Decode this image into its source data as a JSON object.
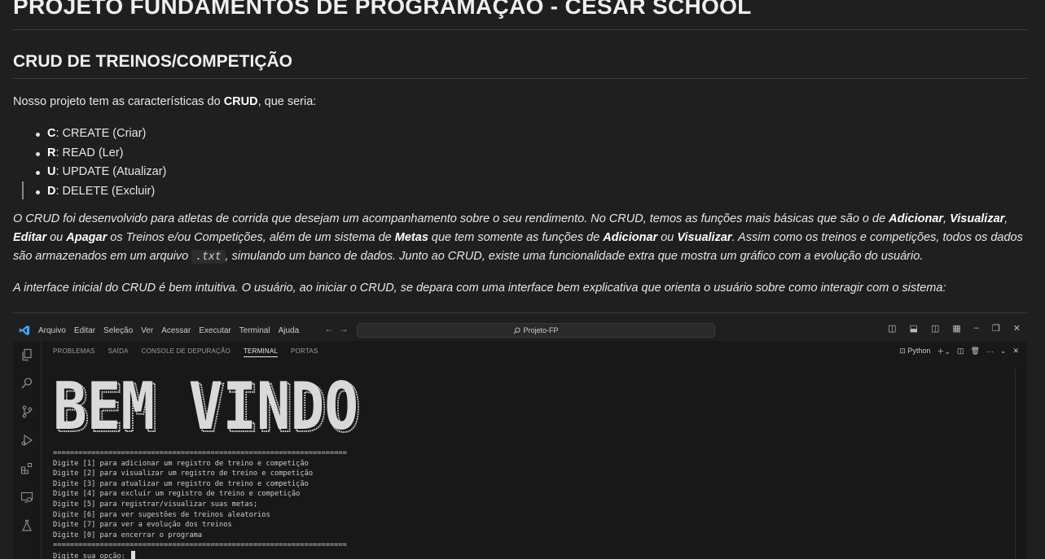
{
  "header": {
    "title": "PROJETO FUNDAMENTOS DE PROGRAMAÇÃO - CESAR SCHOOL",
    "subtitle": "CRUD DE TREINOS/COMPETIÇÃO"
  },
  "intro": {
    "before": "Nosso projeto tem as características do ",
    "bold": "CRUD",
    "after": ", que seria:"
  },
  "crud_items": [
    {
      "letter": "C",
      "text": ": CREATE (Criar)"
    },
    {
      "letter": "R",
      "text": ": READ (Ler)"
    },
    {
      "letter": "U",
      "text": ": UPDATE (Atualizar)"
    },
    {
      "letter": "D",
      "text": ": DELETE (Excluir)"
    }
  ],
  "description": {
    "t1": "O CRUD foi desenvolvido para atletas de corrida que desejam um acompanhamento sobre o seu rendimento. No CRUD, temos as funções mais básicas que são o de ",
    "b1": "Adicionar",
    "t2": ", ",
    "b2": "Visualizar",
    "t3": ", ",
    "b3": "Editar",
    "t4": " ou ",
    "b4": "Apagar",
    "t5": " os Treinos e/ou Competições, além de um sistema de ",
    "b5": "Metas",
    "t6": " que tem somente as funções de ",
    "b6": "Adicionar",
    "t7": " ou ",
    "b7": "Visualizar",
    "t8": ". Assim como os treinos e competições, todos os dados são armazenados em um arquivo ",
    "code": ".txt",
    "t9": ", simulando um banco de dados. Junto ao CRUD, existe uma funcionalidade extra que mostra um gráfico com a evolução do usuário."
  },
  "interface_note": "A interface inicial do CRUD é bem intuitiva. O usuário, ao iniciar o CRUD, se depara com uma interface bem explicativa que orienta o usuário sobre como interagir com o sistema:",
  "vscode": {
    "menu": [
      "Arquivo",
      "Editar",
      "Seleção",
      "Ver",
      "Acessar",
      "Executar",
      "Terminal",
      "Ajuda"
    ],
    "search_text": "Projeto-FP",
    "panel_tabs": [
      "PROBLEMAS",
      "SAÍDA",
      "CONSOLE DE DEPURAÇÃO",
      "TERMINAL",
      "PORTAS"
    ],
    "active_tab": "TERMINAL",
    "terminal_profile": "Python",
    "banner_text": "BEM VINDO",
    "terminal_lines": [
      "=====================================================================",
      "Digite [1] para adicionar um registro de treino e competição",
      "Digite [2] para visualizar um registro de treino e competição",
      "Digite [3] para atualizar um registro de treino e competição",
      "Digite [4] para excluir um registro de treino e competição",
      "Digite [5] para registrar/visualizar suas metas;",
      "Digite [6] para ver sugestões de treinos aleatorios",
      "Digite [7] para ver a evolução dos treinos",
      "Digite [0] para encerrar o programa",
      "=====================================================================",
      "Digite sua opção: "
    ]
  }
}
